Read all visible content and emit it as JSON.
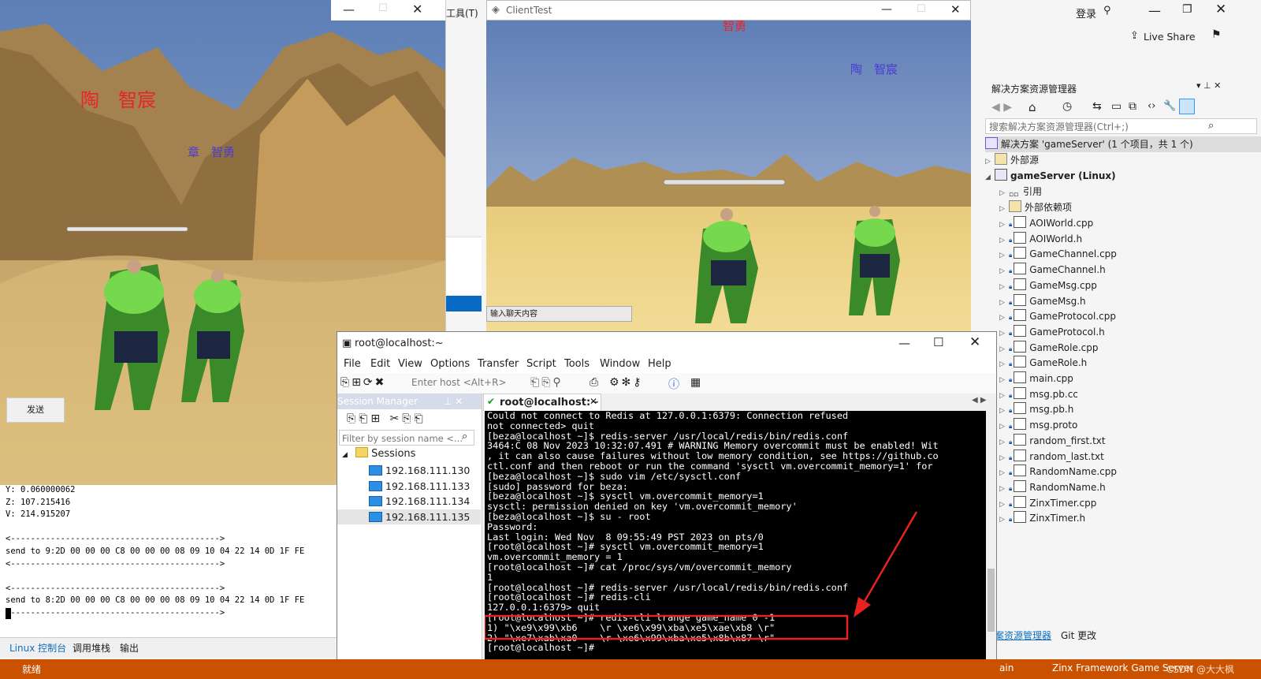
{
  "vs": {
    "login": "登录",
    "live_share": "Live Share",
    "tools_menu": "工具(T)",
    "status_ready": "就绪",
    "status_right": "Zinx Framework Game Server",
    "status_left_partial": "ain",
    "watermark": "CSDN @大大枫"
  },
  "solution_explorer": {
    "title": "解决方案资源管理器",
    "search_placeholder": "搜索解决方案资源管理器(Ctrl+;)",
    "solution": "解决方案 'gameServer' (1 个项目，共 1 个)",
    "external": "外部源",
    "project": "gameServer (Linux)",
    "refs": "引用",
    "deps": "外部依赖项",
    "files": [
      "AOIWorld.cpp",
      "AOIWorld.h",
      "GameChannel.cpp",
      "GameChannel.h",
      "GameMsg.cpp",
      "GameMsg.h",
      "GameProtocol.cpp",
      "GameProtocol.h",
      "GameRole.cpp",
      "GameRole.h",
      "main.cpp",
      "msg.pb.cc",
      "msg.pb.h",
      "msg.proto",
      "random_first.txt",
      "random_last.txt",
      "RandomName.cpp",
      "RandomName.h",
      "ZinxTimer.cpp",
      "ZinxTimer.h"
    ],
    "tab1": "方案资源管理器",
    "tab2": "Git 更改"
  },
  "game_left": {
    "name1": "陶　智宸",
    "name2": "章　智勇",
    "send_button": "发送"
  },
  "game_right": {
    "title": "ClientTest",
    "name1": "陶　智宸",
    "name_top": "智勇",
    "chat_placeholder": "输入聊天内容"
  },
  "console": {
    "lines": [
      "Y: 0.060000062",
      "Z: 107.215416",
      "V: 214.915207",
      "",
      "<------------------------------------------>",
      "send to 9:2D 00 00 00 C8 00 00 00 08 09 10 04 22 14 0D 1F FE",
      "<------------------------------------------>",
      "",
      "<------------------------------------------>",
      "send to 8:2D 00 00 00 C8 00 00 00 08 09 10 04 22 14 0D 1F FE",
      "<------------------------------------------>"
    ],
    "tab1": "Linux 控制台",
    "tab2": "调用堆栈",
    "tab3": "输出"
  },
  "crt": {
    "title": "root@localhost:~",
    "menu": [
      "File",
      "Edit",
      "View",
      "Options",
      "Transfer",
      "Script",
      "Tools",
      "Window",
      "Help"
    ],
    "host_placeholder": "Enter host <Alt+R>",
    "session_manager": "Session Manager",
    "filter_placeholder": "Filter by session name <...",
    "sessions_folder": "Sessions",
    "sessions": [
      "192.168.111.130",
      "192.168.111.133",
      "192.168.111.134",
      "192.168.111.135"
    ],
    "tab": "root@localhost:~",
    "terminal_lines": [
      "Could not connect to Redis at 127.0.0.1:6379: Connection refused",
      "not connected> quit",
      "[beza@localhost ~]$ redis-server /usr/local/redis/bin/redis.conf",
      "3464:C 08 Nov 2023 10:32:07.491 # WARNING Memory overcommit must be enabled! Wit",
      ", it can also cause failures without low memory condition, see https://github.co",
      "ctl.conf and then reboot or run the command 'sysctl vm.overcommit_memory=1' for",
      "[beza@localhost ~]$ sudo vim /etc/sysctl.conf",
      "[sudo] password for beza:",
      "[beza@localhost ~]$ sysctl vm.overcommit_memory=1",
      "sysctl: permission denied on key 'vm.overcommit_memory'",
      "[beza@localhost ~]$ su - root",
      "Password:",
      "Last login: Wed Nov  8 09:55:49 PST 2023 on pts/0",
      "[root@localhost ~]# sysctl vm.overcommit_memory=1",
      "vm.overcommit_memory = 1",
      "[root@localhost ~]# cat /proc/sys/vm/overcommit_memory",
      "1",
      "[root@localhost ~]# redis-server /usr/local/redis/bin/redis.conf",
      "[root@localhost ~]# redis-cli",
      "127.0.0.1:6379> quit",
      "[root@localhost ~]# redis-cli lrange game_name 0 -1",
      "1) \"\\xe9\\x99\\xb6    \\r \\xe6\\x99\\xba\\xe5\\xae\\xb8 \\r\"",
      "2) \"\\xe7\\xab\\xa0    \\r \\xe6\\x99\\xba\\xe5\\x8b\\x87 \\r\"",
      "[root@localhost ~]# "
    ]
  },
  "colors": {
    "vs_status": "#ca5100",
    "highlight_box": "#e8231f",
    "name_red": "#e8232a",
    "name_blue": "#4b3bd1"
  }
}
